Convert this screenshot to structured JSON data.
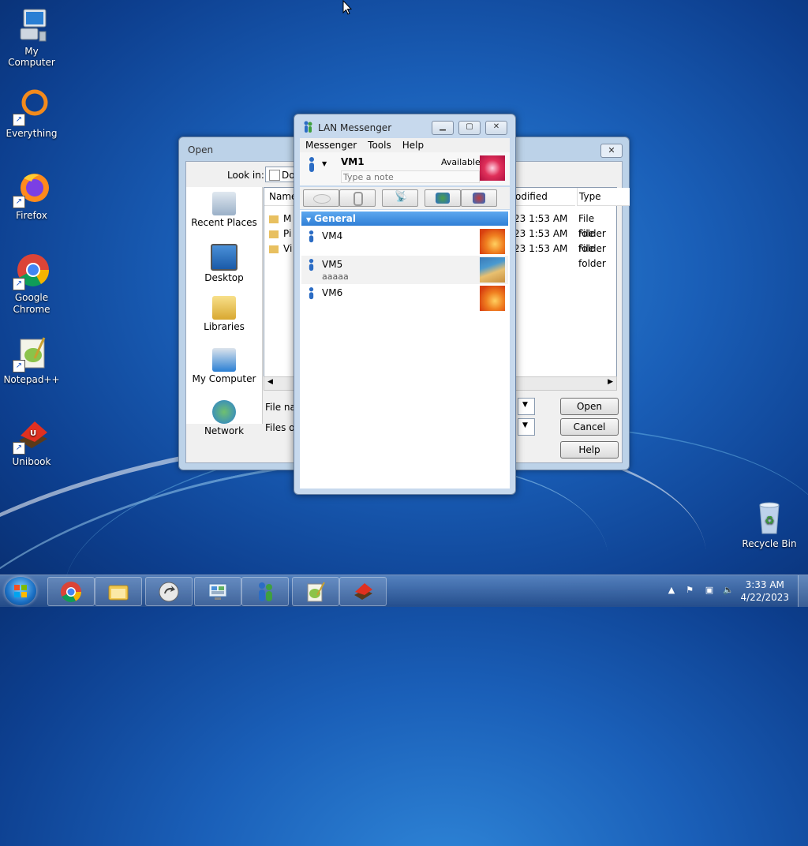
{
  "desktop": {
    "icons": [
      {
        "label": "My Computer"
      },
      {
        "label": "Everything"
      },
      {
        "label": "Firefox"
      },
      {
        "label": "Google Chrome"
      },
      {
        "label": "Notepad++"
      },
      {
        "label": "Unibook"
      },
      {
        "label": "Recycle Bin"
      }
    ]
  },
  "open_dialog": {
    "title": "Open",
    "look_in_label": "Look in:",
    "look_in_value": "Do",
    "places": [
      {
        "label": "Recent Places"
      },
      {
        "label": "Desktop"
      },
      {
        "label": "Libraries"
      },
      {
        "label": "My Computer"
      },
      {
        "label": "Network"
      }
    ],
    "columns": {
      "name": "Name",
      "modified": "odified",
      "type": "Type"
    },
    "files": [
      {
        "name": "M",
        "modified": "23 1:53 AM",
        "type": "File folder"
      },
      {
        "name": "Pi",
        "modified": "23 1:53 AM",
        "type": "File folder"
      },
      {
        "name": "Vi",
        "modified": "23 1:53 AM",
        "type": "File folder"
      }
    ],
    "file_name_label": "File nam",
    "files_of_type_label": "Files of t",
    "buttons": {
      "open": "Open",
      "cancel": "Cancel",
      "help": "Help"
    }
  },
  "lan_messenger": {
    "title": "LAN Messenger",
    "menu": [
      "Messenger",
      "Tools",
      "Help"
    ],
    "user": {
      "name": "VM1",
      "status": "Available",
      "note_placeholder": "Type a note"
    },
    "group": "General",
    "contacts": [
      {
        "name": "VM4",
        "note": ""
      },
      {
        "name": "VM5",
        "note": "aaaaa"
      },
      {
        "name": "VM6",
        "note": ""
      }
    ]
  },
  "taskbar": {
    "clock_time": "3:33 AM",
    "clock_date": "4/22/2023"
  },
  "colors": {
    "group_header": "#2f7fd6",
    "desktop_bg": "#1a5fb8"
  }
}
